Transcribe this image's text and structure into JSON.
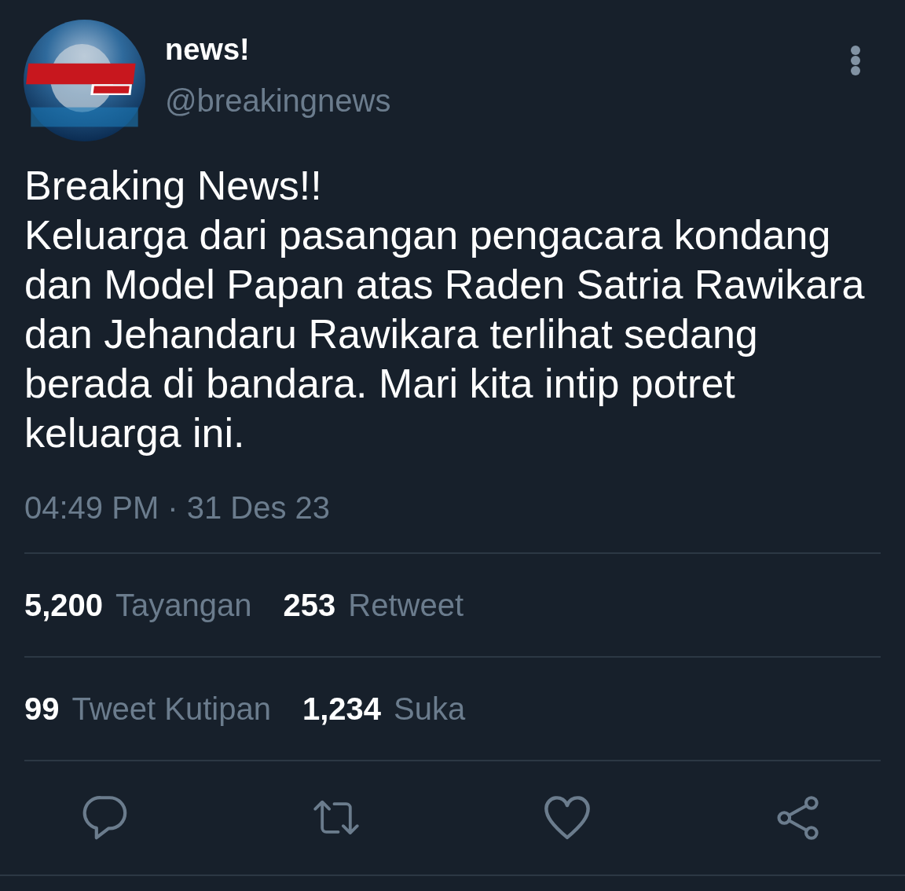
{
  "author": {
    "name": "news!",
    "handle": "@breakingnews"
  },
  "tweet": {
    "text": "Breaking News!!\nKeluarga dari pasangan pengacara kondang dan Model Papan atas Raden Satria Rawikara dan Jehandaru Rawikara terlihat sedang berada di bandara. Mari kita intip potret keluarga ini.",
    "timestamp": "04:49 PM · 31 Des 23"
  },
  "stat_rows": [
    {
      "items": [
        {
          "count": "5,200",
          "label": "Tayangan"
        },
        {
          "count": "253",
          "label": "Retweet"
        }
      ]
    },
    {
      "items": [
        {
          "count": "99",
          "label": "Tweet Kutipan"
        },
        {
          "count": "1,234",
          "label": "Suka"
        }
      ]
    }
  ],
  "actions": [
    {
      "kind": "reply"
    },
    {
      "kind": "retweet"
    },
    {
      "kind": "like"
    },
    {
      "kind": "share"
    }
  ]
}
